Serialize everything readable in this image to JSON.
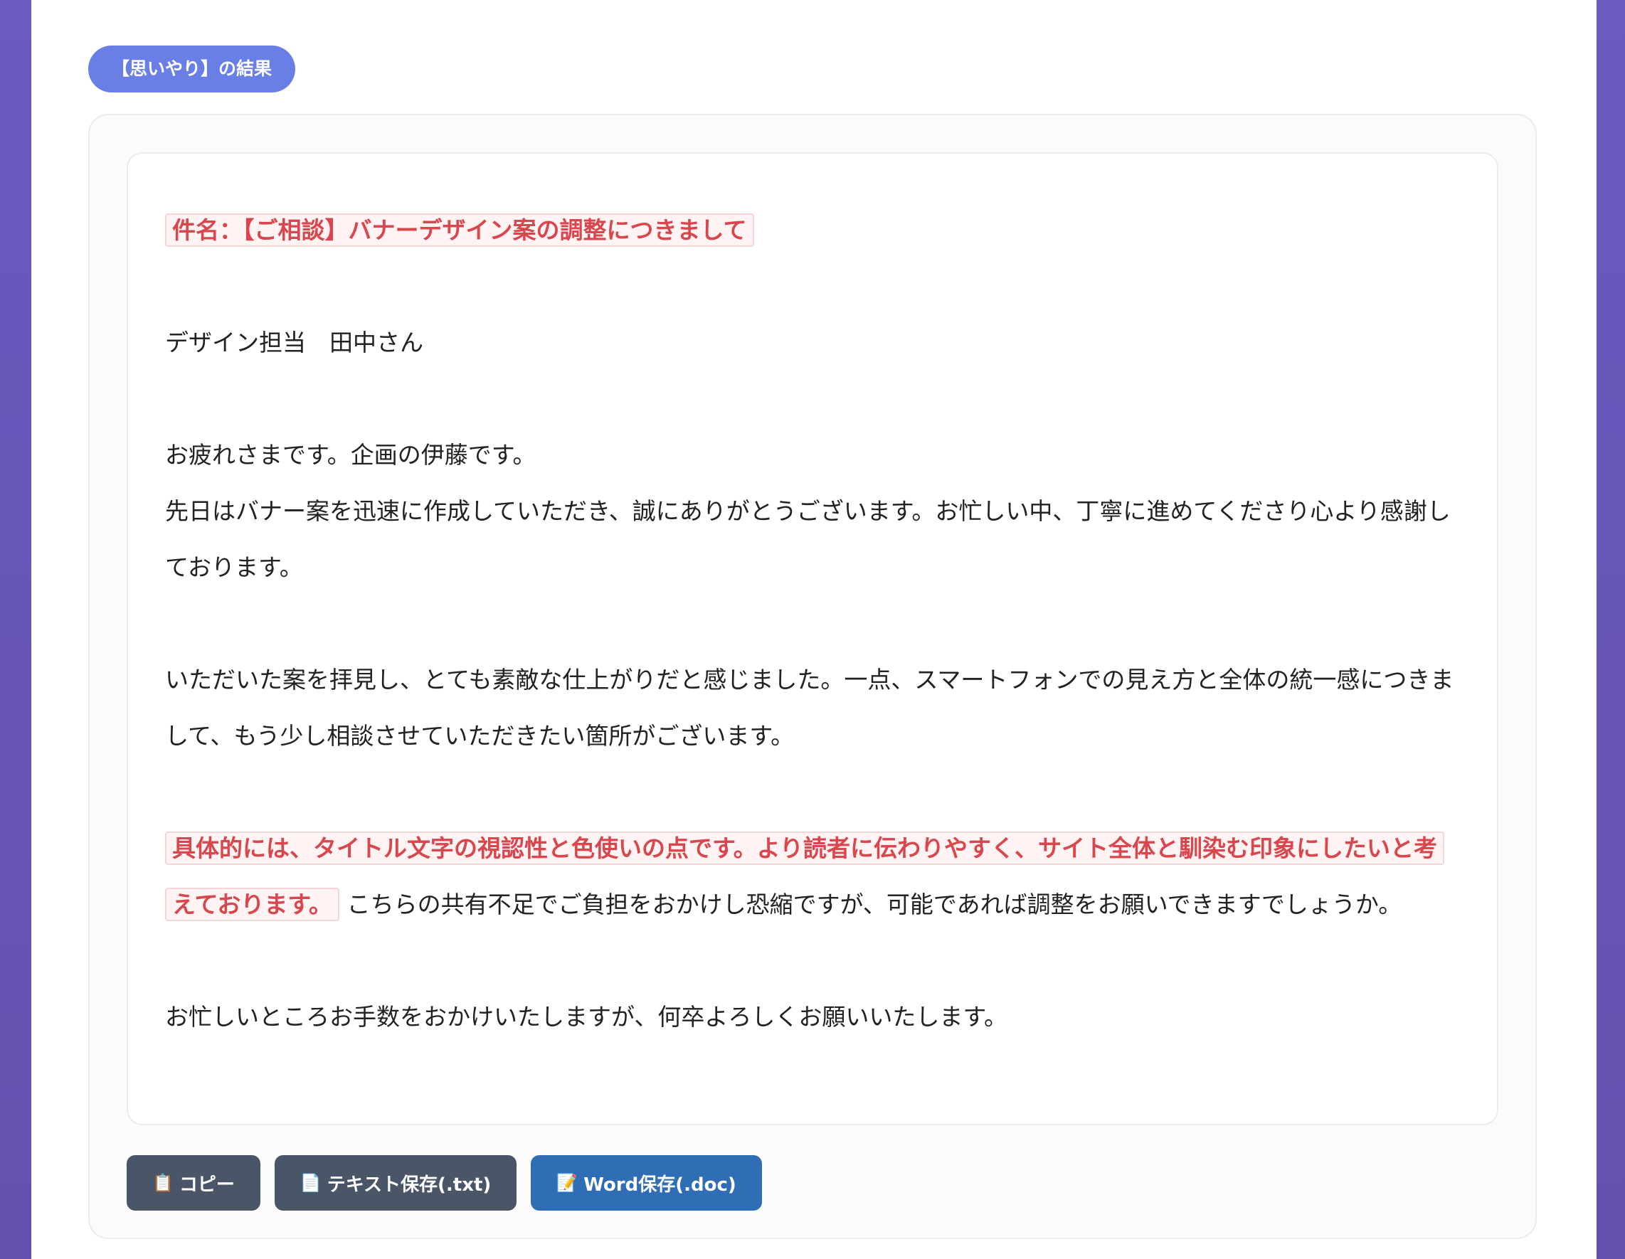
{
  "header": {
    "badge_label": "【思いやり】の結果"
  },
  "email": {
    "subject": "件名：【ご相談】バナーデザイン案の調整につきまして",
    "recipient": "デザイン担当　田中さん",
    "greeting": "お疲れさまです。企画の伊藤です。",
    "thanks": "先日はバナー案を迅速に作成していただき、誠にありがとうございます。お忙しい中、丁寧に進めてくださり心より感謝しております。",
    "impression": "いただいた案を拝見し、とても素敵な仕上がりだと感じました。一点、スマートフォンでの見え方と全体の統一感につきまして、もう少し相談させていただきたい箇所がございます。",
    "request_highlight": "具体的には、タイトル文字の視認性と色使いの点です。より読者に伝わりやすく、サイト全体と馴染む印象にしたいと考えております。",
    "request_rest": "こちらの共有不足でご負担をおかけし恐縮ですが、可能であれば調整をお願いできますでしょうか。",
    "closing": "お忙しいところお手数をおかけいたしますが、何卒よろしくお願いいたします。"
  },
  "actions": {
    "copy_label": "コピー",
    "copy_icon": "📋",
    "txt_label": "テキスト保存(.txt)",
    "txt_icon": "📄",
    "doc_label": "Word保存(.doc)",
    "doc_icon": "📝"
  },
  "colors": {
    "highlight_text": "#d8474d",
    "badge": "#6a7fe6",
    "dark_button": "#4a5567",
    "word_button": "#2f6db4"
  }
}
